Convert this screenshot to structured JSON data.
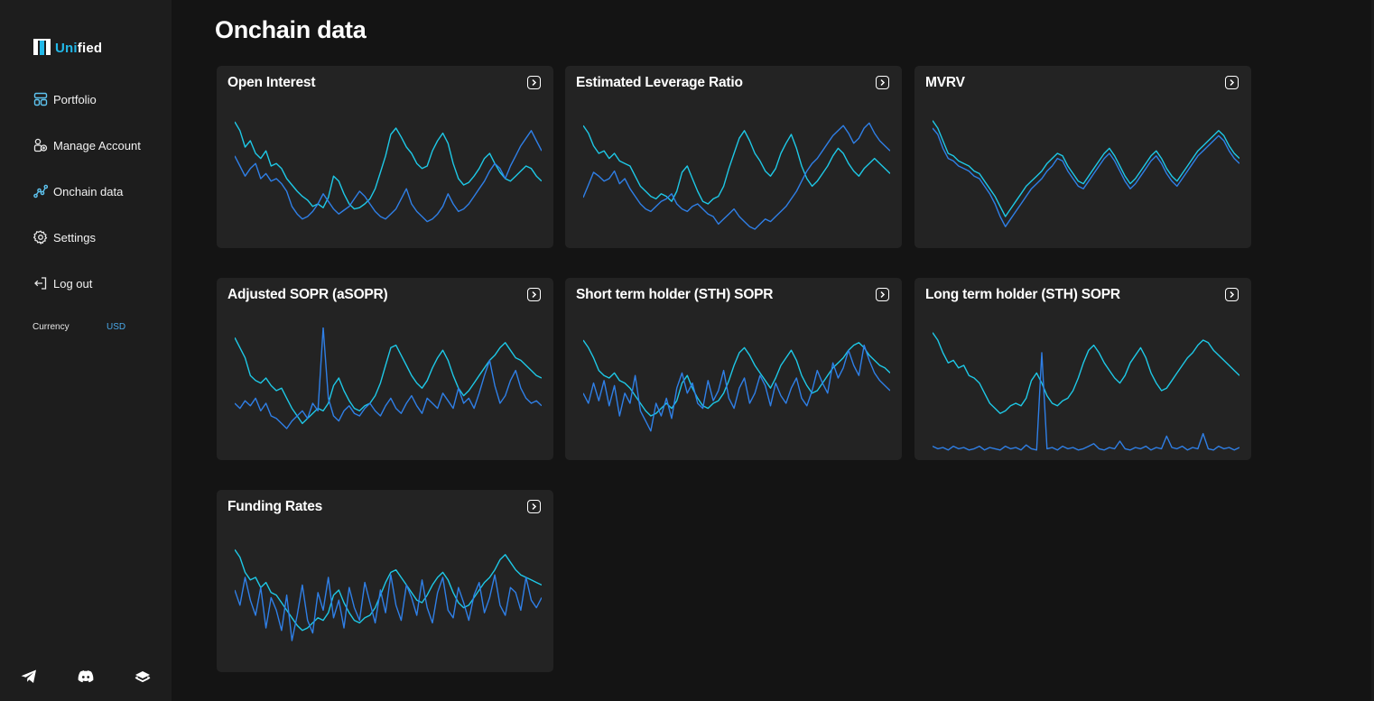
{
  "brand": {
    "name_accent": "Uni",
    "name_rest": "fied"
  },
  "nav": [
    {
      "label": "Portfolio",
      "icon": "portfolio-icon"
    },
    {
      "label": "Manage Account",
      "icon": "manage-account-icon"
    },
    {
      "label": "Onchain data",
      "icon": "onchain-icon"
    },
    {
      "label": "Settings",
      "icon": "gear-icon"
    },
    {
      "label": "Log out",
      "icon": "logout-icon"
    }
  ],
  "currency": {
    "label": "Currency",
    "value": "USD"
  },
  "footer": {
    "icons": [
      "telegram-icon",
      "discord-icon",
      "docs-icon"
    ]
  },
  "page": {
    "title": "Onchain data"
  },
  "colors": {
    "line_primary": "#1ec8e6",
    "line_secondary": "#2f7fe6",
    "card_bg": "#232323",
    "accent": "#22b8e8"
  },
  "cards": [
    {
      "title": "Open Interest",
      "chart_data": {
        "type": "line",
        "series": [
          {
            "values": [
              95,
              88,
              75,
              80,
              70,
              66,
              72,
              60,
              62,
              58,
              50,
              45,
              40,
              36,
              33,
              28,
              30,
              27,
              35,
              52,
              48,
              38,
              30,
              26,
              27,
              30,
              34,
              42,
              55,
              68,
              85,
              90,
              83,
              75,
              70,
              62,
              58,
              60,
              72,
              80,
              86,
              78,
              62,
              50,
              45,
              47,
              52,
              58,
              66,
              70,
              62,
              55,
              50,
              48,
              52,
              56,
              60,
              58,
              52,
              48
            ]
          },
          {
            "values": [
              68,
              60,
              52,
              58,
              62,
              50,
              54,
              48,
              50,
              46,
              40,
              28,
              22,
              18,
              20,
              24,
              30,
              38,
              32,
              26,
              22,
              25,
              28,
              34,
              40,
              36,
              30,
              24,
              20,
              18,
              22,
              26,
              34,
              42,
              30,
              24,
              20,
              16,
              18,
              22,
              28,
              38,
              30,
              24,
              26,
              30,
              36,
              42,
              48,
              56,
              62,
              58,
              50,
              60,
              68,
              76,
              82,
              88,
              80,
              72
            ]
          }
        ]
      }
    },
    {
      "title": "Estimated Leverage Ratio",
      "chart_data": {
        "type": "line",
        "series": [
          {
            "values": [
              92,
              86,
              76,
              70,
              72,
              66,
              70,
              64,
              62,
              60,
              52,
              44,
              40,
              36,
              34,
              38,
              36,
              32,
              40,
              55,
              60,
              50,
              40,
              32,
              30,
              34,
              36,
              44,
              58,
              70,
              82,
              88,
              80,
              70,
              64,
              56,
              52,
              58,
              70,
              78,
              85,
              74,
              60,
              50,
              44,
              48,
              54,
              60,
              68,
              74,
              70,
              62,
              56,
              52,
              58,
              62,
              66,
              62,
              58,
              54
            ]
          },
          {
            "values": [
              35,
              45,
              55,
              52,
              48,
              50,
              56,
              46,
              50,
              42,
              36,
              30,
              26,
              24,
              28,
              32,
              34,
              38,
              30,
              26,
              24,
              28,
              30,
              26,
              22,
              20,
              14,
              18,
              22,
              26,
              20,
              16,
              12,
              10,
              14,
              18,
              16,
              20,
              24,
              28,
              34,
              40,
              48,
              56,
              62,
              66,
              72,
              78,
              84,
              88,
              92,
              86,
              78,
              82,
              90,
              94,
              86,
              80,
              76,
              72
            ]
          }
        ]
      }
    },
    {
      "title": "MVRV",
      "chart_data": {
        "type": "line",
        "series": [
          {
            "values": [
              96,
              90,
              80,
              70,
              68,
              64,
              62,
              60,
              56,
              54,
              48,
              42,
              36,
              28,
              20,
              26,
              32,
              38,
              44,
              48,
              52,
              56,
              62,
              66,
              70,
              68,
              60,
              54,
              48,
              46,
              52,
              58,
              64,
              70,
              74,
              68,
              60,
              52,
              46,
              50,
              56,
              62,
              68,
              72,
              66,
              58,
              52,
              48,
              54,
              60,
              66,
              72,
              76,
              80,
              84,
              88,
              84,
              76,
              70,
              66
            ]
          },
          {
            "values": [
              90,
              85,
              74,
              66,
              64,
              60,
              58,
              56,
              52,
              50,
              44,
              38,
              30,
              20,
              12,
              18,
              24,
              30,
              36,
              42,
              46,
              50,
              56,
              60,
              66,
              64,
              56,
              50,
              44,
              42,
              48,
              54,
              60,
              66,
              70,
              64,
              56,
              48,
              42,
              46,
              52,
              58,
              64,
              68,
              62,
              54,
              48,
              44,
              50,
              56,
              62,
              68,
              72,
              76,
              80,
              84,
              80,
              72,
              66,
              62
            ]
          }
        ]
      }
    },
    {
      "title": "Adjusted SOPR (aSOPR)",
      "chart_data": {
        "type": "line",
        "series": [
          {
            "values": [
              92,
              84,
              76,
              62,
              58,
              56,
              60,
              54,
              50,
              52,
              44,
              36,
              30,
              24,
              28,
              32,
              36,
              34,
              40,
              54,
              60,
              50,
              42,
              36,
              34,
              38,
              40,
              46,
              56,
              70,
              84,
              86,
              78,
              70,
              62,
              56,
              52,
              58,
              68,
              76,
              82,
              74,
              62,
              52,
              46,
              50,
              56,
              62,
              68,
              74,
              78,
              84,
              88,
              82,
              76,
              74,
              70,
              66,
              62,
              60
            ]
          },
          {
            "values": [
              40,
              36,
              42,
              38,
              44,
              34,
              40,
              30,
              28,
              24,
              20,
              26,
              30,
              34,
              28,
              40,
              34,
              100,
              44,
              30,
              26,
              34,
              38,
              32,
              30,
              36,
              40,
              34,
              30,
              38,
              44,
              36,
              32,
              40,
              46,
              38,
              32,
              44,
              40,
              36,
              48,
              42,
              36,
              52,
              40,
              44,
              36,
              48,
              62,
              74,
              54,
              40,
              46,
              58,
              66,
              52,
              44,
              40,
              42,
              38
            ]
          }
        ]
      }
    },
    {
      "title": "Short term holder (STH) SOPR",
      "chart_data": {
        "type": "line",
        "series": [
          {
            "values": [
              90,
              84,
              76,
              66,
              62,
              60,
              64,
              58,
              56,
              52,
              46,
              40,
              34,
              30,
              32,
              36,
              40,
              36,
              42,
              56,
              62,
              52,
              44,
              38,
              36,
              40,
              42,
              48,
              58,
              70,
              80,
              84,
              78,
              70,
              64,
              58,
              52,
              60,
              70,
              76,
              82,
              74,
              62,
              54,
              48,
              50,
              56,
              62,
              68,
              72,
              76,
              82,
              86,
              88,
              84,
              78,
              74,
              70,
              68,
              64
            ]
          },
          {
            "values": [
              48,
              40,
              56,
              42,
              58,
              38,
              54,
              30,
              48,
              40,
              62,
              34,
              26,
              18,
              40,
              30,
              44,
              28,
              52,
              64,
              48,
              56,
              40,
              36,
              58,
              42,
              50,
              66,
              44,
              36,
              52,
              60,
              40,
              48,
              62,
              54,
              38,
              56,
              46,
              40,
              52,
              60,
              44,
              38,
              50,
              66,
              56,
              48,
              72,
              60,
              68,
              82,
              70,
              62,
              86,
              74,
              64,
              58,
              54,
              50
            ]
          }
        ]
      }
    },
    {
      "title": "Long term holder (STH) SOPR",
      "chart_data": {
        "type": "line",
        "series": [
          {
            "values": [
              96,
              90,
              80,
              72,
              74,
              68,
              70,
              62,
              60,
              56,
              48,
              40,
              36,
              32,
              34,
              38,
              40,
              38,
              44,
              58,
              64,
              56,
              46,
              40,
              38,
              42,
              44,
              50,
              60,
              72,
              82,
              86,
              80,
              72,
              66,
              60,
              56,
              62,
              72,
              78,
              84,
              76,
              64,
              56,
              50,
              52,
              58,
              64,
              70,
              76,
              80,
              86,
              90,
              88,
              82,
              78,
              74,
              70,
              66,
              62
            ]
          },
          {
            "values": [
              6,
              4,
              5,
              3,
              6,
              4,
              5,
              3,
              4,
              6,
              3,
              5,
              4,
              3,
              6,
              4,
              5,
              3,
              7,
              4,
              3,
              80,
              4,
              5,
              3,
              6,
              4,
              5,
              3,
              4,
              6,
              8,
              4,
              3,
              5,
              4,
              10,
              4,
              3,
              5,
              4,
              6,
              3,
              5,
              4,
              14,
              5,
              4,
              6,
              3,
              5,
              4,
              16,
              4,
              3,
              6,
              4,
              5,
              3,
              5
            ]
          }
        ]
      }
    },
    {
      "title": "Funding Rates",
      "chart_data": {
        "type": "line",
        "series": [
          {
            "values": [
              92,
              86,
              74,
              68,
              70,
              62,
              66,
              58,
              56,
              50,
              44,
              38,
              32,
              28,
              30,
              34,
              38,
              36,
              42,
              56,
              60,
              50,
              42,
              36,
              34,
              38,
              40,
              46,
              56,
              66,
              74,
              76,
              70,
              64,
              58,
              52,
              50,
              56,
              64,
              70,
              74,
              68,
              58,
              50,
              46,
              48,
              54,
              60,
              66,
              70,
              76,
              84,
              88,
              82,
              76,
              72,
              70,
              68,
              66,
              64
            ]
          },
          {
            "values": [
              60,
              48,
              70,
              52,
              40,
              62,
              30,
              54,
              44,
              28,
              56,
              20,
              40,
              64,
              36,
              26,
              58,
              44,
              70,
              38,
              52,
              30,
              62,
              46,
              36,
              66,
              50,
              34,
              60,
              42,
              72,
              48,
              36,
              64,
              54,
              40,
              68,
              46,
              34,
              58,
              70,
              44,
              38,
              62,
              50,
              36,
              56,
              66,
              42,
              54,
              72,
              48,
              40,
              62,
              58,
              44,
              70,
              52,
              46,
              54
            ]
          }
        ]
      }
    }
  ]
}
